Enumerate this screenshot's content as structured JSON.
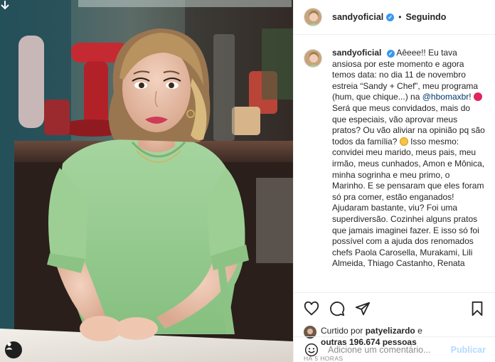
{
  "colors": {
    "accent": "#0095f6",
    "verified": "#3897f0",
    "mention": "#00376b",
    "publish_disabled": "#b3dbff",
    "muted": "#8e8e8e"
  },
  "photo": {
    "subject": "woman in green blouse in kitchen studio",
    "back_icon": "arrow-down-icon",
    "user_tag_icon": "user-tag-icon"
  },
  "header": {
    "username": "sandyoficial",
    "verified_icon": "verified-badge-icon",
    "separator": "•",
    "follow_status": "Seguindo"
  },
  "caption": {
    "username": "sandyoficial",
    "text_1": "Aêeee!! Eu tava ansiosa por este momento e agora temos data: no dia 11 de novembro estreia “Sandy + Chef”, meu programa (hum, que chique...) na ",
    "mention": "@hbomaxbr",
    "text_2": "! ",
    "balloon_emoji": "red-balloon-emoji",
    "text_3": " Será que meus convidados, mais do que especiais, vão aprovar meus pratos? Ou vão aliviar na opinião pq são todos da família? ",
    "grin_emoji": "grinning-face-emoji",
    "text_4": " Isso mesmo: convidei meu marido, meus pais, meu irmão, meus cunhados, Amon e Mônica, minha sogrinha e meu primo, o Marinho. E se pensaram que eles foram só pra comer, estão enganados! Ajudaram bastante, viu? Foi uma superdiversão. Cozinhei alguns pratos que jamais imaginei fazer. E isso só foi possível com a ajuda dos renomados chefs Paola Carosella, Murakami, Lili Almeida, Thiago Castanho, Renata"
  },
  "actions": {
    "like_icon": "heart-icon",
    "comment_icon": "comment-icon",
    "share_icon": "paper-plane-icon",
    "save_icon": "bookmark-icon"
  },
  "likes": {
    "prefix": "Curtido por ",
    "first_user": "patyelizardo",
    "joiner": " e",
    "others": "outras 196.674 pessoas"
  },
  "timestamp": "HÁ 5 HORAS",
  "comment": {
    "emoji_icon": "smiley-icon",
    "placeholder": "Adicione um comentário...",
    "publish_label": "Publicar"
  }
}
